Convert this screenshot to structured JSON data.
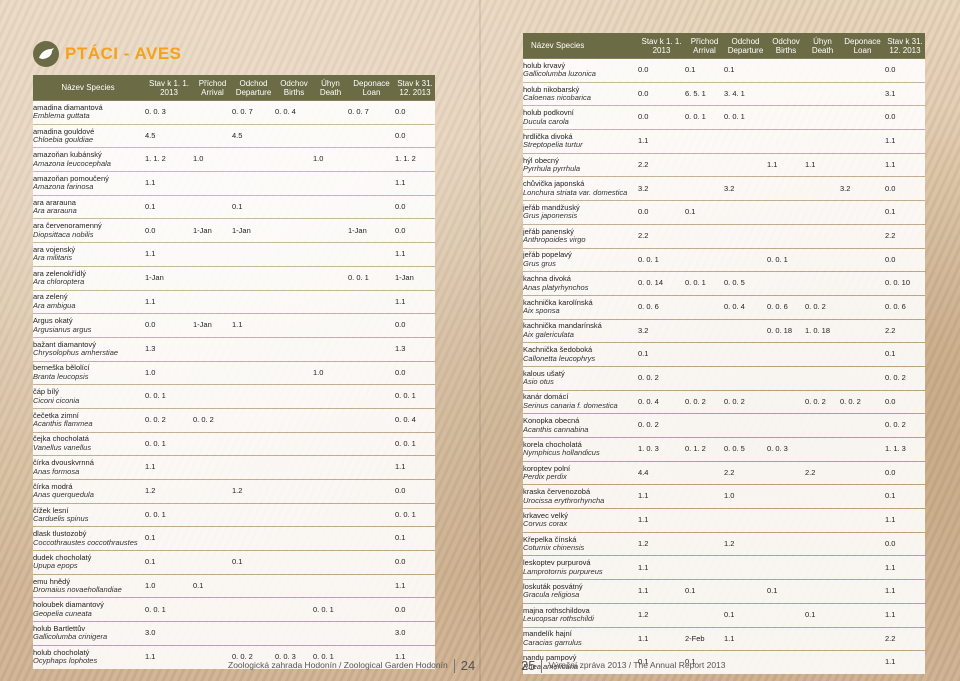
{
  "title": "PTÁCI - AVES",
  "columns": [
    "Název Species",
    "Stav k 1. 1. 2013",
    "Příchod Arrival",
    "Odchod Departure",
    "Odchov Births",
    "Úhyn Death",
    "Deponace Loan",
    "Stav k 31. 12. 2013"
  ],
  "left_rows": [
    {
      "cz": "amadina diamantová",
      "la": "Emblema guttata",
      "v": [
        "0. 0. 3",
        "",
        "0. 0. 7",
        "0. 0. 4",
        "",
        "0. 0. 7",
        "0.0"
      ]
    },
    {
      "cz": "amadina gouldové",
      "la": "Chloebia gouldiae",
      "v": [
        "4.5",
        "",
        "4.5",
        "",
        "",
        "",
        "0.0"
      ]
    },
    {
      "cz": "amazoňan kubánský",
      "la": "Amazona leucocephala",
      "v": [
        "1. 1. 2",
        "1.0",
        "",
        "",
        "1.0",
        "",
        "1. 1. 2"
      ]
    },
    {
      "cz": "amazoňan pomoučený",
      "la": "Amazona farinosa",
      "v": [
        "1.1",
        "",
        "",
        "",
        "",
        "",
        "1.1"
      ]
    },
    {
      "cz": "ara ararauna",
      "la": "Ara ararauna",
      "v": [
        "0.1",
        "",
        "0.1",
        "",
        "",
        "",
        "0.0"
      ]
    },
    {
      "cz": "ara červenoramenný",
      "la": "Diopsittaca nobilis",
      "v": [
        "0.0",
        "1-Jan",
        "1-Jan",
        "",
        "",
        "1-Jan",
        "0.0"
      ]
    },
    {
      "cz": "ara vojenský",
      "la": "Ara militaris",
      "v": [
        "1.1",
        "",
        "",
        "",
        "",
        "",
        "1.1"
      ]
    },
    {
      "cz": "ara zelenokřídlý",
      "la": "Ara chloroptera",
      "v": [
        "1-Jan",
        "",
        "",
        "",
        "",
        "0. 0. 1",
        "1-Jan"
      ]
    },
    {
      "cz": "ara zelený",
      "la": "Ara ambigua",
      "v": [
        "1.1",
        "",
        "",
        "",
        "",
        "",
        "1.1"
      ]
    },
    {
      "cz": "Argus okatý",
      "la": "Argusianus argus",
      "v": [
        "0.0",
        "1-Jan",
        "1.1",
        "",
        "",
        "",
        "0.0"
      ]
    },
    {
      "cz": "bažant diamantový",
      "la": "Chrysolophus amherstiae",
      "v": [
        "1.3",
        "",
        "",
        "",
        "",
        "",
        "1.3"
      ]
    },
    {
      "cz": "berneška bělolící",
      "la": "Branta leucopsis",
      "v": [
        "1.0",
        "",
        "",
        "",
        "1.0",
        "",
        "0.0"
      ]
    },
    {
      "cz": "čáp bílý",
      "la": "Ciconi ciconia",
      "v": [
        "0. 0. 1",
        "",
        "",
        "",
        "",
        "",
        "0. 0. 1"
      ]
    },
    {
      "cz": "čečetka zimní",
      "la": "Acanthis flammea",
      "v": [
        "0. 0. 2",
        "0. 0. 2",
        "",
        "",
        "",
        "",
        "0. 0. 4"
      ]
    },
    {
      "cz": "čejka chocholatá",
      "la": "Vanellus vanellus",
      "v": [
        "0. 0. 1",
        "",
        "",
        "",
        "",
        "",
        "0. 0. 1"
      ]
    },
    {
      "cz": "čírka dvouskvrnná",
      "la": "Anas formosa",
      "v": [
        "1.1",
        "",
        "",
        "",
        "",
        "",
        "1.1"
      ]
    },
    {
      "cz": "čírka modrá",
      "la": "Anas querquedula",
      "v": [
        "1.2",
        "",
        "1.2",
        "",
        "",
        "",
        "0.0"
      ]
    },
    {
      "cz": "čížek lesní",
      "la": "Carduelis spinus",
      "v": [
        "0. 0. 1",
        "",
        "",
        "",
        "",
        "",
        "0. 0. 1"
      ]
    },
    {
      "cz": "dlask tlustozobý",
      "la": "Coccothraustes coccothraustes",
      "v": [
        "0.1",
        "",
        "",
        "",
        "",
        "",
        "0.1"
      ]
    },
    {
      "cz": "dudek chocholatý",
      "la": "Upupa epops",
      "v": [
        "0.1",
        "",
        "0.1",
        "",
        "",
        "",
        "0.0"
      ]
    },
    {
      "cz": "emu hnědý",
      "la": "Dromaius novaehollandiae",
      "v": [
        "1.0",
        "0.1",
        "",
        "",
        "",
        "",
        "1.1"
      ]
    },
    {
      "cz": "holoubek diamantový",
      "la": "Geopelia cuneata",
      "v": [
        "0. 0. 1",
        "",
        "",
        "",
        "0. 0. 1",
        "",
        "0.0"
      ]
    },
    {
      "cz": "holub Bartlettův",
      "la": "Gallicolumba crinigera",
      "v": [
        "3.0",
        "",
        "",
        "",
        "",
        "",
        "3.0"
      ]
    },
    {
      "cz": "holub chocholatý",
      "la": "Ocyphaps lophotes",
      "v": [
        "1.1",
        "",
        "0. 0. 2",
        "0. 0. 3",
        "0. 0. 1",
        "",
        "1.1"
      ]
    }
  ],
  "right_rows": [
    {
      "cz": "holub krvavý",
      "la": "Gallicolumba luzonica",
      "v": [
        "0.0",
        "0.1",
        "0.1",
        "",
        "",
        "",
        "0.0"
      ]
    },
    {
      "cz": "holub nikobarský",
      "la": "Caloenas nicobarica",
      "v": [
        "0.0",
        "6. 5. 1",
        "3. 4. 1",
        "",
        "",
        "",
        "3.1"
      ]
    },
    {
      "cz": "holub podkovní",
      "la": "Ducula carola",
      "v": [
        "0.0",
        "0. 0. 1",
        "0. 0. 1",
        "",
        "",
        "",
        "0.0"
      ]
    },
    {
      "cz": "hrdlička divoká",
      "la": "Streptopelia turtur",
      "v": [
        "1.1",
        "",
        "",
        "",
        "",
        "",
        "1.1"
      ]
    },
    {
      "cz": "hýl obecný",
      "la": "Pyrrhula pyrrhula",
      "v": [
        "2.2",
        "",
        "",
        "1.1",
        "1.1",
        "",
        "1.1"
      ]
    },
    {
      "cz": "chůvička japonská",
      "la": "Lonchura striata var. domestica",
      "v": [
        "3.2",
        "",
        "3.2",
        "",
        "",
        "3.2",
        "0.0"
      ]
    },
    {
      "cz": "jeřáb mandžuský",
      "la": "Grus japonensis",
      "v": [
        "0.0",
        "0.1",
        "",
        "",
        "",
        "",
        "0.1"
      ]
    },
    {
      "cz": "jeřáb panenský",
      "la": "Anthropoides virgo",
      "v": [
        "2.2",
        "",
        "",
        "",
        "",
        "",
        "2.2"
      ]
    },
    {
      "cz": "jeřáb popelavý",
      "la": "Grus grus",
      "v": [
        "0. 0. 1",
        "",
        "",
        "0. 0. 1",
        "",
        "",
        "0.0"
      ]
    },
    {
      "cz": "kachna divoká",
      "la": "Anas platyrhynchos",
      "v": [
        "0. 0. 14",
        "0. 0. 1",
        "0. 0. 5",
        "",
        "",
        "",
        "0. 0. 10"
      ]
    },
    {
      "cz": "kachnička karolínská",
      "la": "Aix sponsa",
      "v": [
        "0. 0. 6",
        "",
        "0. 0. 4",
        "0. 0. 6",
        "0. 0. 2",
        "",
        "0. 0. 6"
      ]
    },
    {
      "cz": "kachnička mandarínská",
      "la": "Aix galericulata",
      "v": [
        "3.2",
        "",
        "",
        "0. 0. 18",
        "1. 0. 18",
        "",
        "2.2"
      ]
    },
    {
      "cz": "Kachnička šedoboká",
      "la": "Callonetta leucophrys",
      "v": [
        "0.1",
        "",
        "",
        "",
        "",
        "",
        "0.1"
      ]
    },
    {
      "cz": "kalous ušatý",
      "la": "Asio otus",
      "v": [
        "0. 0. 2",
        "",
        "",
        "",
        "",
        "",
        "0. 0. 2"
      ]
    },
    {
      "cz": "kanár domácí",
      "la": "Serinus canaria f. domestica",
      "v": [
        "0. 0. 4",
        "0. 0. 2",
        "0. 0. 2",
        "",
        "0. 0. 2",
        "0. 0. 2",
        "0.0"
      ]
    },
    {
      "cz": "Konopka obecná",
      "la": "Acanthis cannabina",
      "v": [
        "0. 0. 2",
        "",
        "",
        "",
        "",
        "",
        "0. 0. 2"
      ]
    },
    {
      "cz": "korela chocholatá",
      "la": "Nymphicus hollandicus",
      "v": [
        "1. 0. 3",
        "0. 1. 2",
        "0. 0. 5",
        "0. 0. 3",
        "",
        "",
        "1. 1. 3"
      ]
    },
    {
      "cz": "koroptev polní",
      "la": "Perdix perdix",
      "v": [
        "4.4",
        "",
        "2.2",
        "",
        "2.2",
        "",
        "0.0"
      ]
    },
    {
      "cz": "kraska červenozobá",
      "la": "Urocissa erythrorhyncha",
      "v": [
        "1.1",
        "",
        "1.0",
        "",
        "",
        "",
        "0.1"
      ]
    },
    {
      "cz": "krkavec velký",
      "la": "Corvus corax",
      "v": [
        "1.1",
        "",
        "",
        "",
        "",
        "",
        "1.1"
      ]
    },
    {
      "cz": "Křepelka čínská",
      "la": "Coturnix chinensis",
      "v": [
        "1.2",
        "",
        "1.2",
        "",
        "",
        "",
        "0.0"
      ]
    },
    {
      "cz": "leskoptev purpurová",
      "la": "Lamprotornis purpureus",
      "v": [
        "1.1",
        "",
        "",
        "",
        "",
        "",
        "1.1"
      ]
    },
    {
      "cz": "loskuták posvátný",
      "la": "Gracula religiosa",
      "v": [
        "1.1",
        "0.1",
        "",
        "0.1",
        "",
        "",
        "1.1"
      ]
    },
    {
      "cz": "majna rothschildova",
      "la": "Leucopsar rothschildi",
      "v": [
        "1.2",
        "",
        "0.1",
        "",
        "0.1",
        "",
        "1.1"
      ]
    },
    {
      "cz": "mandelík hajní",
      "la": "Caracias garrulus",
      "v": [
        "1.1",
        "2-Feb",
        "1.1",
        "",
        "",
        "",
        "2.2"
      ]
    },
    {
      "cz": "nandu pampový",
      "la": "Rhea americana",
      "v": [
        "0.1",
        "0.1",
        "",
        "",
        "",
        "",
        "1.1"
      ]
    }
  ],
  "footer_left": "Zoologická zahrada Hodonín / Zoological Garden Hodonín",
  "footer_left_num": "24",
  "footer_right_num": "25",
  "footer_right": "Výroční zpráva 2013 / The Annual Report 2013"
}
